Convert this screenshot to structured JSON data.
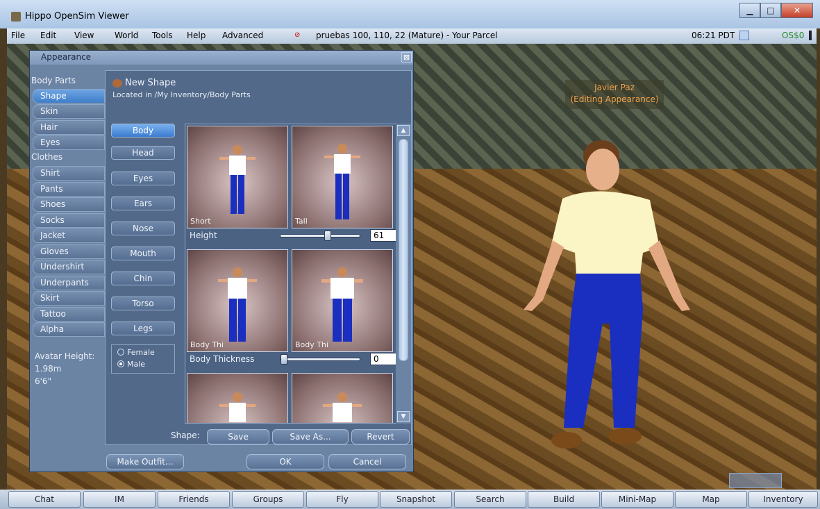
{
  "window": {
    "title": "Hippo OpenSim Viewer",
    "controls": {
      "minimize": "▁",
      "maximize": "□",
      "close": "✕"
    }
  },
  "menubar": {
    "items": [
      "File",
      "Edit",
      "View",
      "World",
      "Tools",
      "Help",
      "Advanced"
    ],
    "location": "pruebas 100, 110, 22 (Mature) - Your Parcel",
    "time": "06:21 PDT",
    "balance": "OS$0"
  },
  "scene": {
    "nametag_name": "Javier Paz",
    "nametag_status": "(Editing Appearance)"
  },
  "appearance": {
    "title": "Appearance",
    "close_icon": "⊠",
    "body_parts_label": "Body Parts",
    "body_parts": [
      "Shape",
      "Skin",
      "Hair",
      "Eyes"
    ],
    "selected_body_part": "Shape",
    "clothes_label": "Clothes",
    "clothes": [
      "Shirt",
      "Pants",
      "Shoes",
      "Socks",
      "Jacket",
      "Gloves",
      "Undershirt",
      "Underpants",
      "Skirt",
      "Tattoo",
      "Alpha"
    ],
    "avatar_height_label": "Avatar Height:",
    "avatar_height_m": "1.98m",
    "avatar_height_ft": "6'6\"",
    "shape_name": "New Shape",
    "shape_location": "Located in /My Inventory/Body Parts",
    "regions": [
      "Body",
      "Head",
      "Eyes",
      "Ears",
      "Nose",
      "Mouth",
      "Chin",
      "Torso",
      "Legs"
    ],
    "selected_region": "Body",
    "sex_options": [
      "Female",
      "Male"
    ],
    "selected_sex": "Male",
    "params": [
      {
        "label": "Height",
        "thumb_left": "Short",
        "thumb_right": "Tall",
        "value": "61",
        "fraction": 0.61
      },
      {
        "label": "Body Thickness",
        "thumb_left": "Body Thi",
        "thumb_right": "Body Thi",
        "value": "0",
        "fraction": 0.0
      }
    ],
    "shape_label": "Shape:",
    "save_label": "Save",
    "save_as_label": "Save As...",
    "revert_label": "Revert",
    "make_outfit_label": "Make Outfit...",
    "ok_label": "OK",
    "cancel_label": "Cancel",
    "scroll_up_icon": "▲",
    "scroll_down_icon": "▼"
  },
  "toolbar": [
    "Chat",
    "IM",
    "Friends",
    "Groups",
    "Fly",
    "Snapshot",
    "Search",
    "Build",
    "Mini-Map",
    "Map",
    "Inventory"
  ],
  "colors": {
    "panel": "#52698a",
    "selected": "#3f7ec9",
    "nametag": "#f3a24a"
  }
}
